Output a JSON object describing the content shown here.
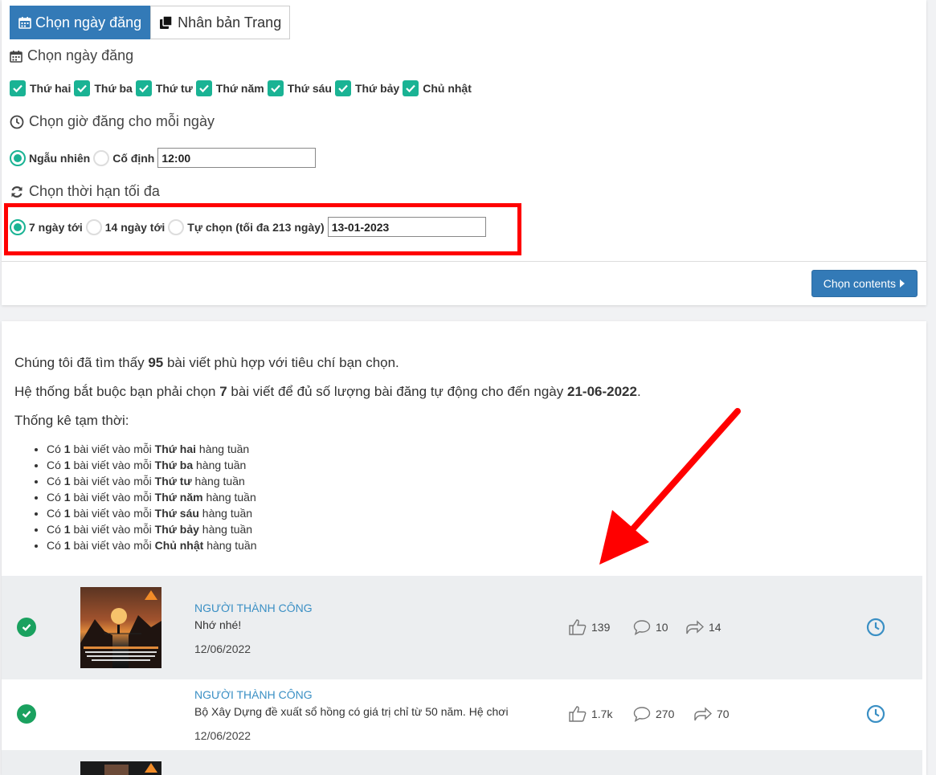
{
  "tabs": [
    {
      "label": "Chọn ngày đăng",
      "active": true
    },
    {
      "label": "Nhân bản Trang",
      "active": false
    }
  ],
  "schedule": {
    "day_title": "Chọn ngày đăng",
    "days": [
      "Thứ hai",
      "Thứ ba",
      "Thứ tư",
      "Thứ năm",
      "Thứ sáu",
      "Thứ bảy",
      "Chủ nhật"
    ],
    "time_title": "Chọn giờ đăng cho mỗi ngày",
    "time_options": [
      {
        "label": "Ngẫu nhiên",
        "selected": true
      },
      {
        "label": "Cố định",
        "selected": false
      }
    ],
    "time_value": "12:00",
    "range_title": "Chọn thời hạn tối đa",
    "range_options": [
      {
        "label": "7 ngày tới",
        "selected": true
      },
      {
        "label": "14 ngày tới",
        "selected": false
      },
      {
        "label": "Tự chọn (tối đa 213 ngày)",
        "selected": false
      }
    ],
    "range_value": "13-01-2023",
    "next_button": "Chọn contents"
  },
  "summary": {
    "line1_pre": "Chúng tôi đã tìm thấy ",
    "line1_count": "95",
    "line1_post": " bài viết phù hợp với tiêu chí bạn chọn.",
    "line2_pre": "Hệ thống bắt buộc bạn phải chọn ",
    "line2_count": "7",
    "line2_mid": " bài viết để đủ số lượng bài đăng tự động cho đến ngày ",
    "line2_date": "21-06-2022",
    "line2_post": ".",
    "stats_title": "Thống kê tạm thời:",
    "stat_prefix": "Có ",
    "stat_count": "1",
    "stat_mid": " bài viết vào mỗi ",
    "stat_suffix": " hàng tuần"
  },
  "posts": [
    {
      "page": "NGƯỜI THÀNH CÔNG",
      "text": "Nhớ nhé!",
      "date": "12/06/2022",
      "likes": "139",
      "comments": "10",
      "shares": "14",
      "has_thumb": true
    },
    {
      "page": "NGƯỜI THÀNH CÔNG",
      "text": "Bộ Xây Dựng đề xuất sổ hồng có giá trị chỉ từ 50 năm. Hệ chơi",
      "date": "12/06/2022",
      "likes": "1.7k",
      "comments": "270",
      "shares": "70",
      "has_thumb": false
    }
  ],
  "colors": {
    "primary": "#337ab7",
    "check": "#1ab394",
    "annotation": "#ff0000",
    "link": "#3a8fc4"
  }
}
